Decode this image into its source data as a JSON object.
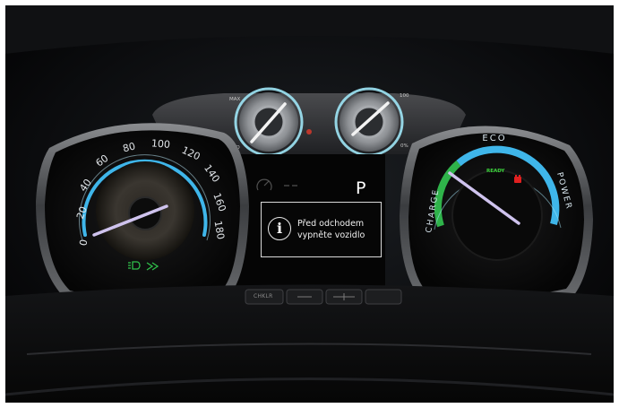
{
  "speedometer": {
    "ticks": [
      "0",
      "20",
      "40",
      "60",
      "80",
      "100",
      "120",
      "140",
      "160",
      "180"
    ],
    "needle_value": 0
  },
  "power_gauge": {
    "labels": {
      "eco": "ECO",
      "charge": "CHARGE",
      "power": "POWER"
    },
    "ready_text": "READY"
  },
  "center_display": {
    "gear": "P",
    "message_line1": "Před odchodem",
    "message_line2": "vypněte vozidlo"
  },
  "mini_gauges": {
    "left": {
      "max_label": "MAX",
      "eco_label": "ECO"
    },
    "right": {
      "top_label": "100",
      "bottom_label": "0%"
    }
  },
  "buttons": {
    "left_label": "CHKLR"
  },
  "colors": {
    "gauge_blue": "#3fb6ea",
    "gauge_green": "#2fb34a",
    "needle": "#cfc3ee",
    "ready_green": "#3ad13a",
    "warning_red": "#e02020",
    "indicator_green": "#2fbf4a"
  },
  "icons": [
    "info-icon",
    "light-indicator-icon",
    "battery-warning-icon",
    "speedometer-needle-icon",
    "power-needle-icon"
  ]
}
